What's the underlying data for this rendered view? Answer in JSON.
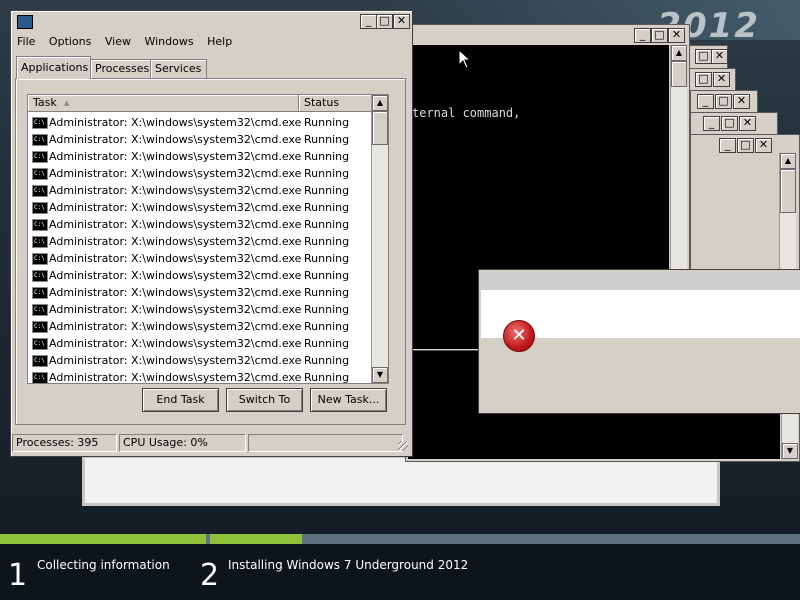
{
  "background": {
    "logo": "2012"
  },
  "task_manager": {
    "menu": [
      "File",
      "Options",
      "View",
      "Windows",
      "Help"
    ],
    "tabs": [
      "Applications",
      "Processes",
      "Services"
    ],
    "columns": {
      "task": "Task",
      "status": "Status"
    },
    "rows": [
      {
        "task": "Administrator: X:\\windows\\system32\\cmd.exe",
        "status": "Running"
      },
      {
        "task": "Administrator: X:\\windows\\system32\\cmd.exe",
        "status": "Running"
      },
      {
        "task": "Administrator: X:\\windows\\system32\\cmd.exe",
        "status": "Running"
      },
      {
        "task": "Administrator: X:\\windows\\system32\\cmd.exe",
        "status": "Running"
      },
      {
        "task": "Administrator: X:\\windows\\system32\\cmd.exe",
        "status": "Running"
      },
      {
        "task": "Administrator: X:\\windows\\system32\\cmd.exe",
        "status": "Running"
      },
      {
        "task": "Administrator: X:\\windows\\system32\\cmd.exe",
        "status": "Running"
      },
      {
        "task": "Administrator: X:\\windows\\system32\\cmd.exe",
        "status": "Running"
      },
      {
        "task": "Administrator: X:\\windows\\system32\\cmd.exe",
        "status": "Running"
      },
      {
        "task": "Administrator: X:\\windows\\system32\\cmd.exe",
        "status": "Running"
      },
      {
        "task": "Administrator: X:\\windows\\system32\\cmd.exe",
        "status": "Running"
      },
      {
        "task": "Administrator: X:\\windows\\system32\\cmd.exe",
        "status": "Running"
      },
      {
        "task": "Administrator: X:\\windows\\system32\\cmd.exe",
        "status": "Running"
      },
      {
        "task": "Administrator: X:\\windows\\system32\\cmd.exe",
        "status": "Running"
      },
      {
        "task": "Administrator: X:\\windows\\system32\\cmd.exe",
        "status": "Running"
      },
      {
        "task": "Administrator: X:\\windows\\system32\\cmd.exe",
        "status": "Running"
      }
    ],
    "buttons": {
      "end_task": "End Task",
      "switch_to": "Switch To",
      "new_task": "New Task..."
    },
    "status": {
      "processes": "Processes: 395",
      "cpu": "CPU Usage: 0%"
    }
  },
  "console": {
    "text": "ternal command,"
  },
  "setup": {
    "steps": [
      {
        "num": "1",
        "label": "Collecting information"
      },
      {
        "num": "2",
        "label": "Installing Windows 7 Underground 2012"
      }
    ],
    "colors": {
      "done": "#8fc13a",
      "pending": "#5e7280"
    }
  }
}
